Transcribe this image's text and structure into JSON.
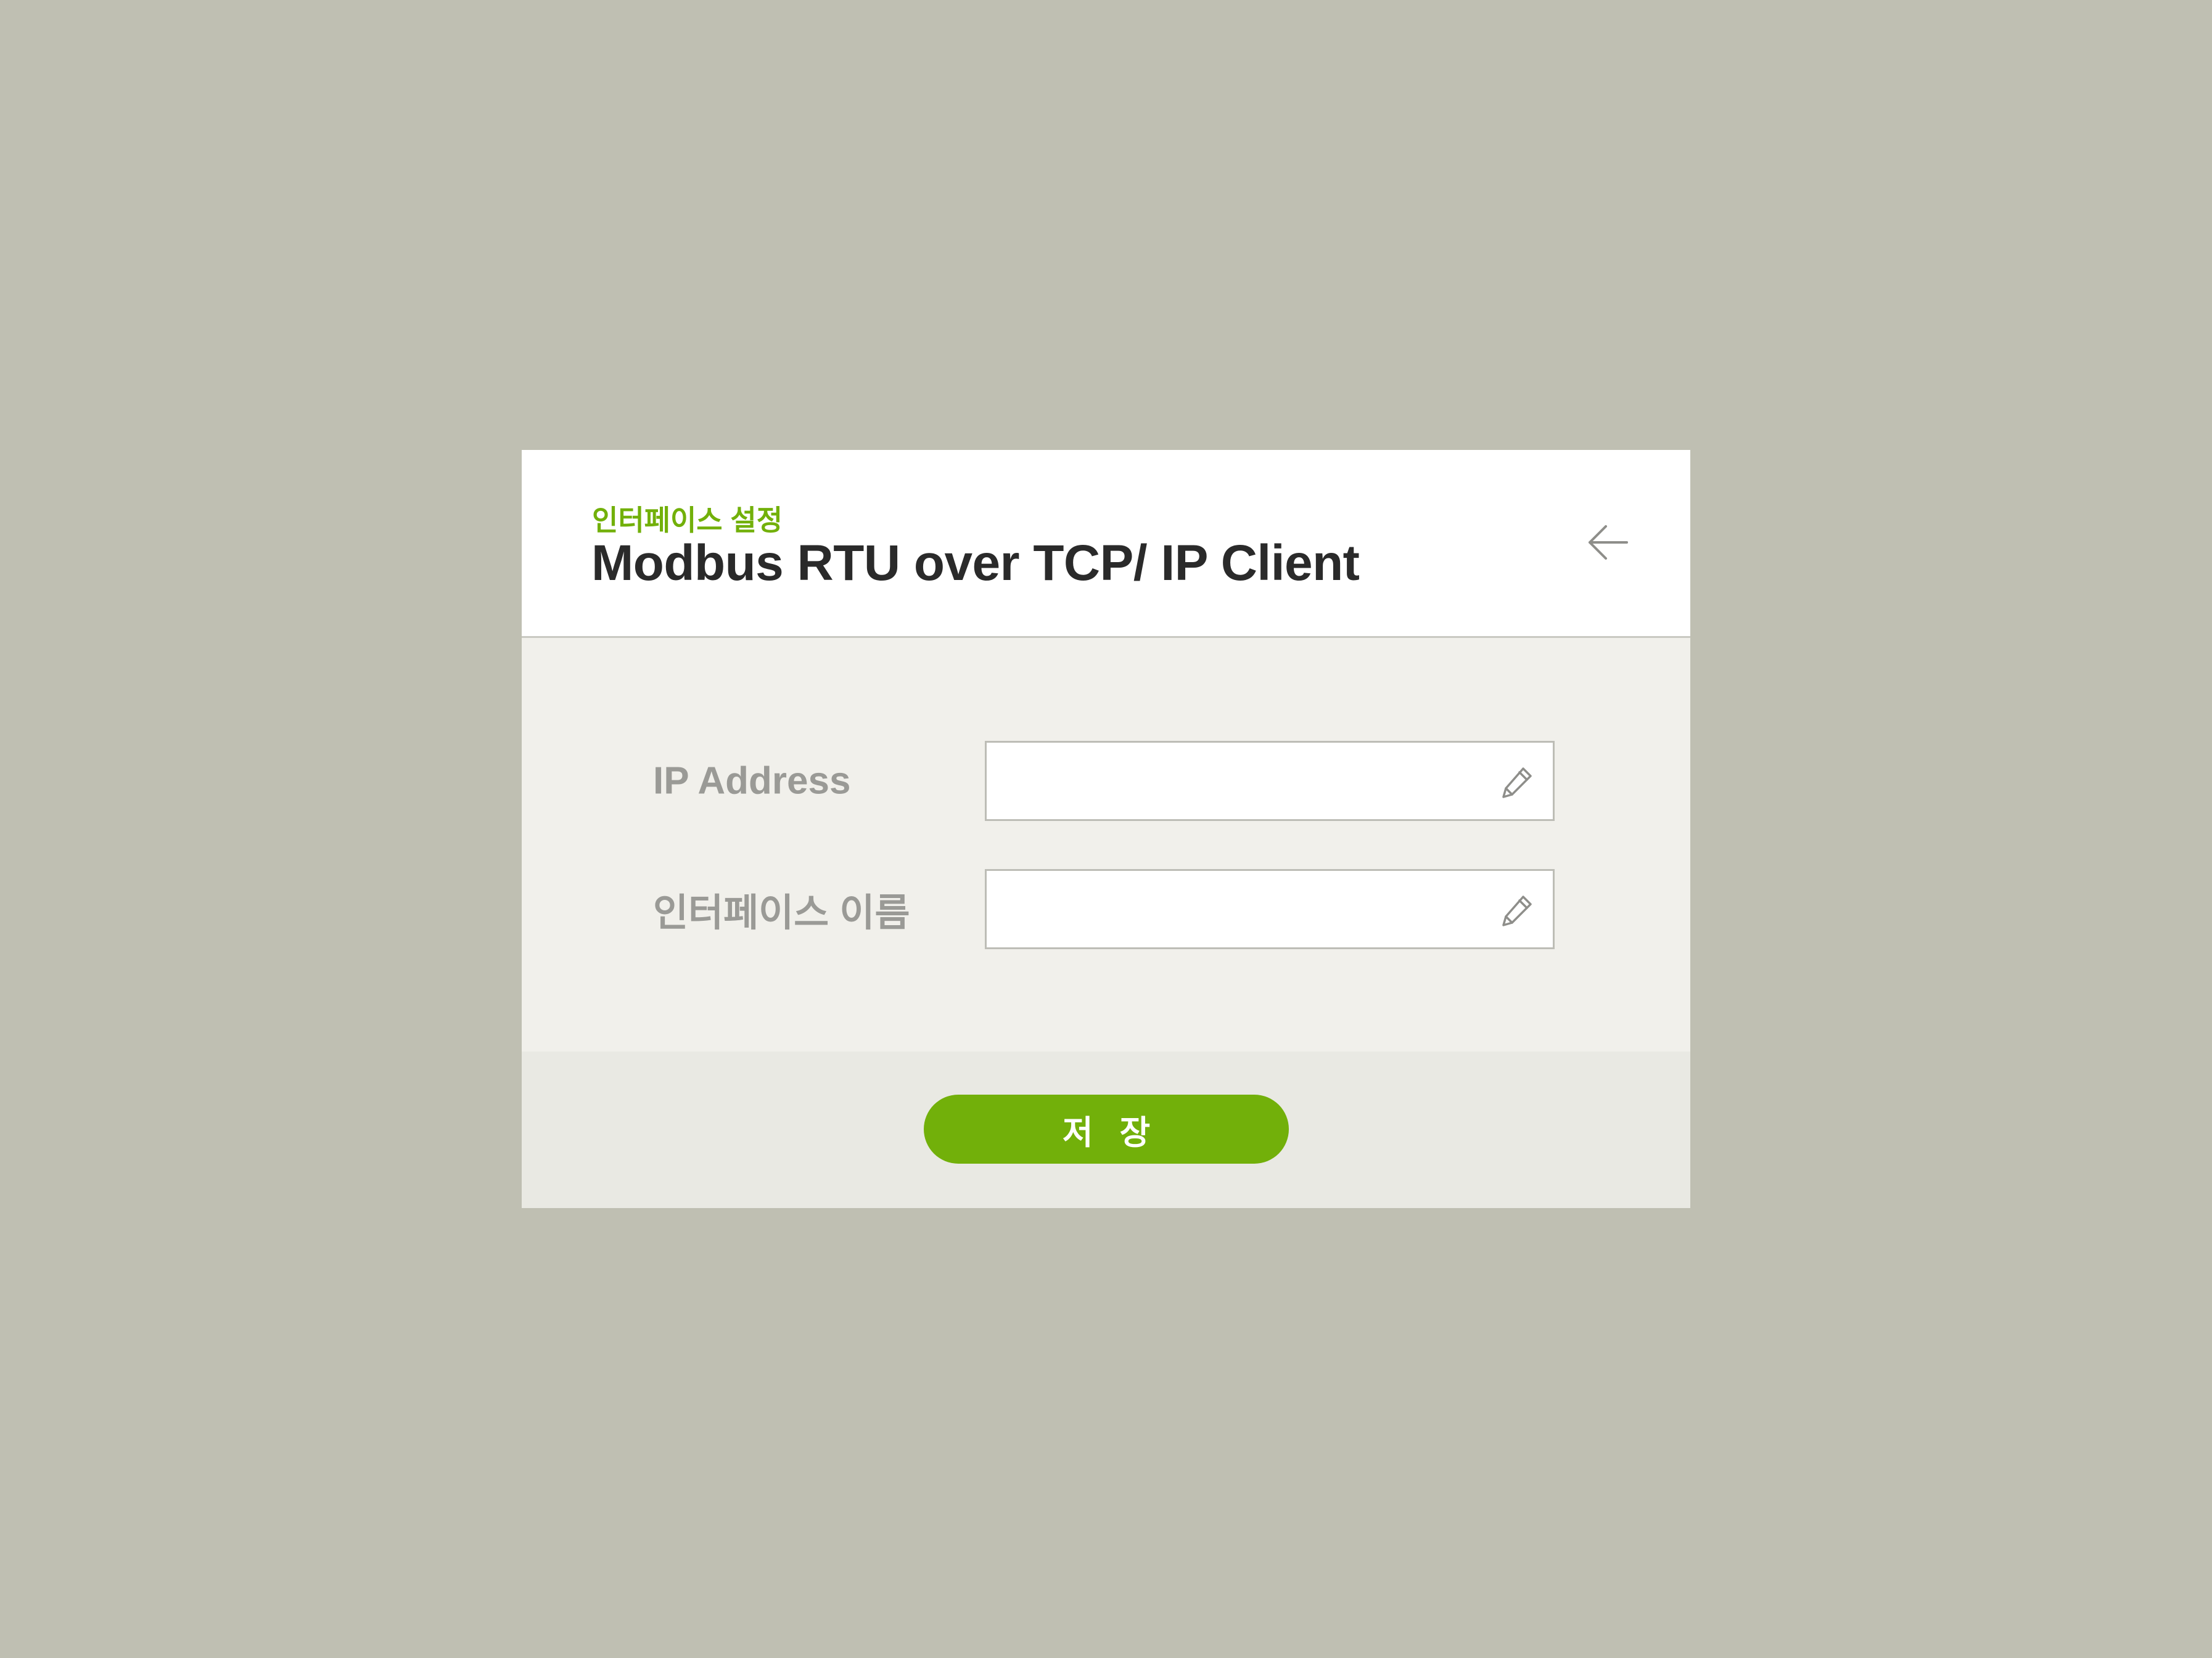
{
  "dialog": {
    "subtitle": "인터페이스 설정",
    "title": "Modbus RTU over TCP/ IP Client",
    "back_icon": "arrow-left-icon"
  },
  "form": {
    "fields": [
      {
        "label": "IP Address",
        "value": "",
        "icon": "pencil-icon"
      },
      {
        "label": "인터페이스 이름",
        "value": "",
        "icon": "pencil-icon"
      }
    ]
  },
  "footer": {
    "save_label": "저 장"
  },
  "colors": {
    "background": "#bfbfb2",
    "accent": "#72b00a",
    "title_text": "#2a2a2a",
    "label_text": "#9a9a96",
    "panel": "#f1f0eb",
    "footer": "#e9e9e3"
  }
}
